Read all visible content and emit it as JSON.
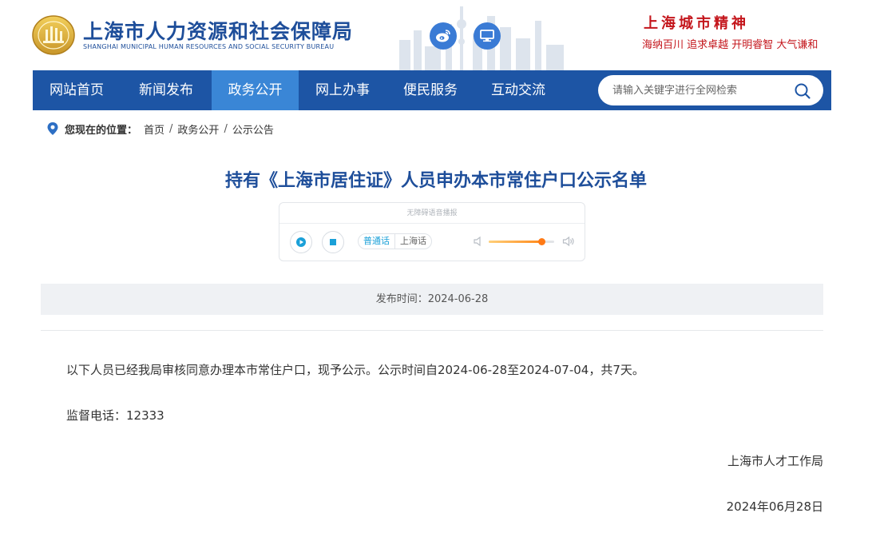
{
  "header": {
    "title": "上海市人力资源和社会保障局",
    "subtitle": "SHANGHAI MUNICIPAL HUMAN RESOURCES AND SOCIAL SECURITY BUREAU",
    "spirit_title": "上海城市精神",
    "spirit_slogan": "海纳百川  追求卓越  开明睿智  大气谦和",
    "brand_color": "#1e4e9a",
    "accent_red": "#c4161c"
  },
  "nav": {
    "items": [
      {
        "label": "网站首页"
      },
      {
        "label": "新闻发布"
      },
      {
        "label": "政务公开"
      },
      {
        "label": "网上办事"
      },
      {
        "label": "便民服务"
      },
      {
        "label": "互动交流"
      }
    ],
    "active": "政务公开",
    "search_placeholder": "请输入关键字进行全网检索",
    "bar_color": "#1d55a5",
    "active_color": "#3a86d6"
  },
  "breadcrumb": {
    "label": "您现在的位置：",
    "items": [
      "首页",
      "政务公开",
      "公示公告"
    ],
    "sep": "/"
  },
  "article": {
    "title": "持有《上海市居住证》人员申办本市常住户口公示名单",
    "publish_label": "发布时间：2024-06-28",
    "paragraph1": "以下人员已经我局审核同意办理本市常住户口，现予公示。公示时间自2024-06-28至2024-07-04，共7天。",
    "paragraph2": "监督电话：12333",
    "signature_org": "上海市人才工作局",
    "signature_date": "2024年06月28日"
  },
  "player": {
    "header": "无障碍语音播报",
    "lang_mandarin": "普通话",
    "lang_shanghainese": "上海话",
    "active_lang": "普通话",
    "volume": 0.8
  },
  "icons": {
    "logo": "bureau-emblem-icon",
    "weibo": "weibo-icon",
    "screen": "monitor-icon",
    "search": "search-icon",
    "location": "location-pin-icon",
    "play": "play-icon",
    "stop": "stop-icon",
    "volume_low": "volume-low-icon",
    "volume_high": "volume-high-icon"
  }
}
